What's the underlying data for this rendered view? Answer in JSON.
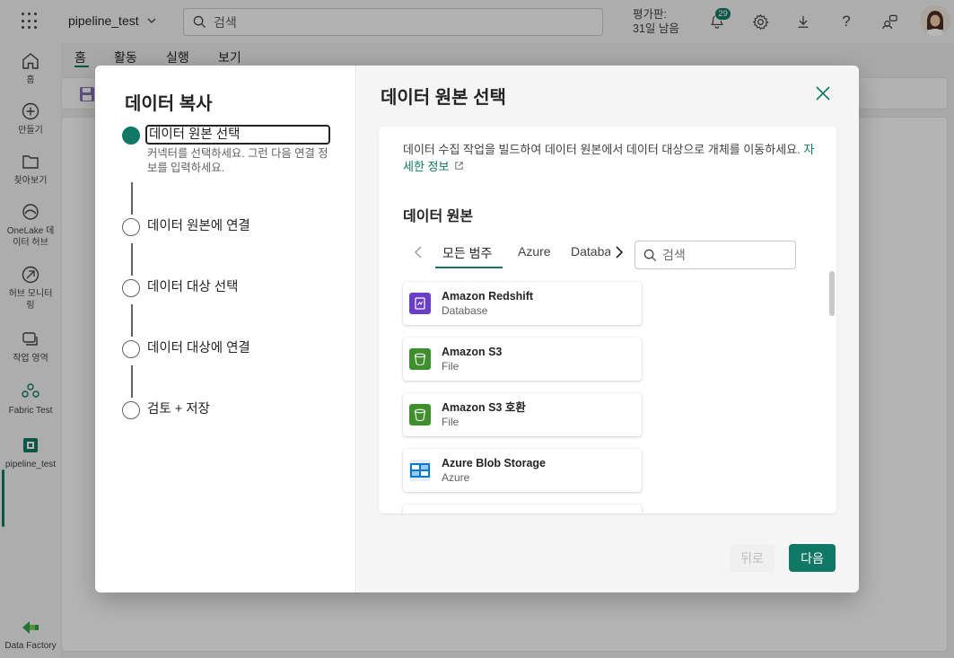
{
  "topbar": {
    "workspace_name": "pipeline_test",
    "search_placeholder": "검색",
    "trial_line1": "평가판:",
    "trial_line2": "31일 남음",
    "notification_count": "29",
    "help_label": "?"
  },
  "rail": {
    "items": [
      {
        "label": "홈",
        "icon": "home-icon"
      },
      {
        "label": "만들기",
        "icon": "plus-circle-icon"
      },
      {
        "label": "찾아보기",
        "icon": "folder-icon"
      },
      {
        "label": "OneLake 데이터 허브",
        "icon": "onelake-icon"
      },
      {
        "label": "허브 모니터링",
        "icon": "monitor-icon"
      },
      {
        "label": "작업 영역",
        "icon": "workspaces-icon"
      },
      {
        "label": "Fabric Test",
        "icon": "fabric-workspace-icon"
      },
      {
        "label": "pipeline_test",
        "icon": "pipeline-icon"
      },
      {
        "label": "Data Factory",
        "icon": "data-factory-icon"
      }
    ]
  },
  "app_tabs": [
    "홈",
    "활동",
    "실행",
    "보기"
  ],
  "dialog": {
    "title": "데이터 복사",
    "steps": [
      {
        "label": "데이터 원본 선택",
        "desc": "커넥터를 선택하세요. 그런 다음 연결 정보를 입력하세요."
      },
      {
        "label": "데이터 원본에 연결"
      },
      {
        "label": "데이터 대상 선택"
      },
      {
        "label": "데이터 대상에 연결"
      },
      {
        "label": "검토 + 저장"
      }
    ],
    "pane_title": "데이터 원본 선택",
    "description": "데이터 수집 작업을 빌드하여 데이터 원본에서 데이터 대상으로 개체를 이동하세요.",
    "learn_more": "자세한 정보",
    "section_title": "데이터 원본",
    "categories": [
      "모든 범주",
      "Azure",
      "Database"
    ],
    "category_search_placeholder": "검색",
    "sources": [
      {
        "name": "Amazon Redshift",
        "type": "Database",
        "icon": "redshift-icon",
        "color": "#6a3fc4"
      },
      {
        "name": "Amazon S3",
        "type": "File",
        "icon": "s3-bucket-icon",
        "color": "#3f8f2f"
      },
      {
        "name": "Amazon S3 호환",
        "type": "File",
        "icon": "s3-bucket-icon",
        "color": "#3f8f2f"
      },
      {
        "name": "Azure Blob Storage",
        "type": "Azure",
        "icon": "blob-storage-icon",
        "color": "#0078d4"
      }
    ],
    "back_label": "뒤로",
    "next_label": "다음"
  },
  "colors": {
    "accent": "#117865"
  }
}
